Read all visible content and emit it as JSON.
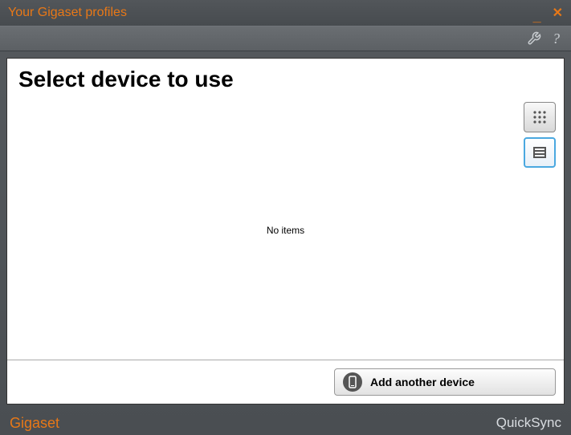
{
  "window": {
    "title": "Your Gigaset profiles"
  },
  "main": {
    "heading": "Select device to use",
    "empty_message": "No items",
    "add_button_label": "Add another device"
  },
  "footer": {
    "brand": "Gigaset",
    "app_name": "QuickSync"
  }
}
